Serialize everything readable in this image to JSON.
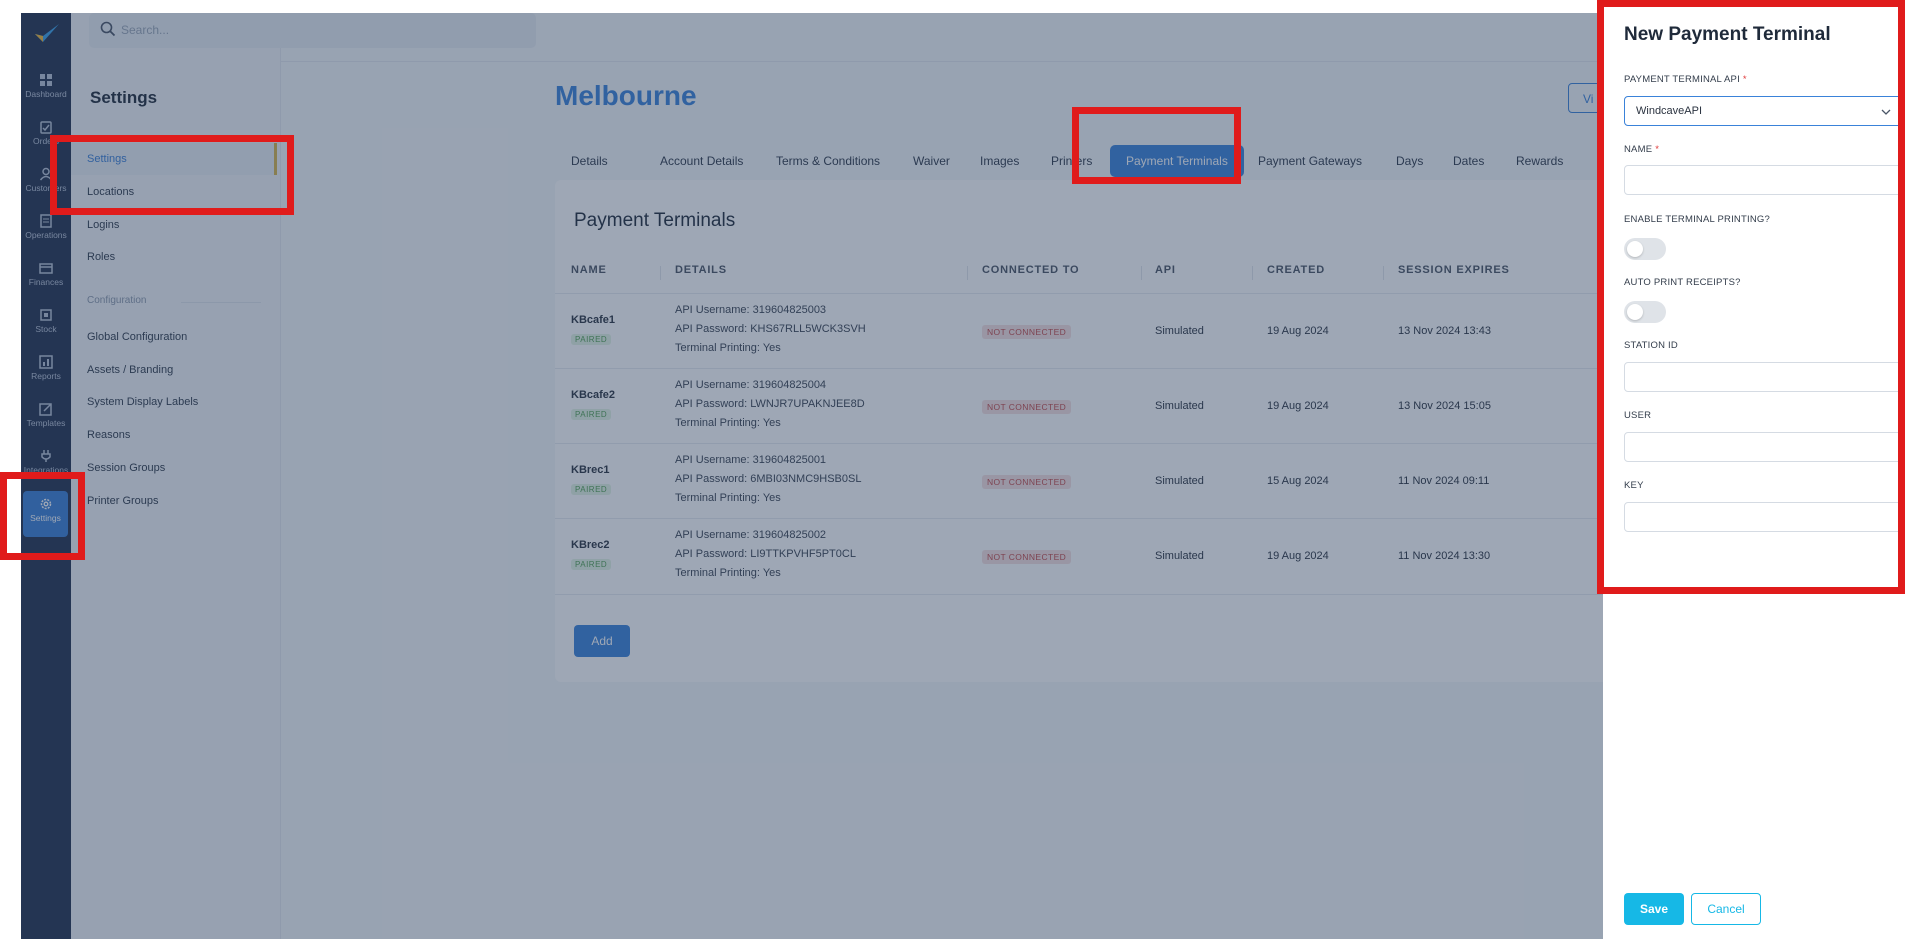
{
  "search": {
    "placeholder": "Search..."
  },
  "rail": {
    "items": [
      {
        "label": "Dashboard",
        "icon": "dashboard-icon"
      },
      {
        "label": "Orders",
        "icon": "orders-icon"
      },
      {
        "label": "Customers",
        "icon": "customers-icon"
      },
      {
        "label": "Operations",
        "icon": "operations-icon"
      },
      {
        "label": "Finances",
        "icon": "finances-icon"
      },
      {
        "label": "Stock",
        "icon": "stock-icon"
      },
      {
        "label": "Reports",
        "icon": "reports-icon"
      },
      {
        "label": "Templates",
        "icon": "templates-icon"
      },
      {
        "label": "Integrations",
        "icon": "integrations-icon"
      },
      {
        "label": "Settings",
        "icon": "gear-icon"
      }
    ]
  },
  "sidebar": {
    "title": "Settings",
    "items": [
      {
        "label": "Settings",
        "active": true
      },
      {
        "label": "Locations"
      },
      {
        "label": "Logins"
      },
      {
        "label": "Roles"
      }
    ],
    "section_label": "Configuration",
    "config_items": [
      {
        "label": "Global Configuration"
      },
      {
        "label": "Assets / Branding"
      },
      {
        "label": "System Display Labels"
      },
      {
        "label": "Reasons"
      },
      {
        "label": "Session Groups"
      },
      {
        "label": "Printer Groups"
      }
    ]
  },
  "main": {
    "location_title": "Melbourne",
    "view_button": "Vi",
    "tabs": [
      "Details",
      "Account Details",
      "Terms & Conditions",
      "Waiver",
      "Images",
      "Printers",
      "Payment Terminals",
      "Payment Gateways",
      "Days",
      "Dates",
      "Rewards"
    ],
    "active_tab": "Payment Terminals",
    "card_title": "Payment Terminals",
    "columns": [
      "NAME",
      "DETAILS",
      "CONNECTED TO",
      "API",
      "CREATED",
      "SESSION EXPIRES"
    ],
    "rows": [
      {
        "name": "KBcafe1",
        "status": "PAIRED",
        "details": [
          "API Username: 319604825003",
          "API Password: KHS67RLL5WCK3SVH",
          "Terminal Printing: Yes"
        ],
        "connected": "NOT CONNECTED",
        "api": "Simulated",
        "created": "19 Aug 2024",
        "expires": "13 Nov 2024 13:43"
      },
      {
        "name": "KBcafe2",
        "status": "PAIRED",
        "details": [
          "API Username: 319604825004",
          "API Password: LWNJR7UPAKNJEE8D",
          "Terminal Printing: Yes"
        ],
        "connected": "NOT CONNECTED",
        "api": "Simulated",
        "created": "19 Aug 2024",
        "expires": "13 Nov 2024 15:05"
      },
      {
        "name": "KBrec1",
        "status": "PAIRED",
        "details": [
          "API Username: 319604825001",
          "API Password: 6MBI03NMC9HSB0SL",
          "Terminal Printing: Yes"
        ],
        "connected": "NOT CONNECTED",
        "api": "Simulated",
        "created": "15 Aug 2024",
        "expires": "11 Nov 2024 09:11"
      },
      {
        "name": "KBrec2",
        "status": "PAIRED",
        "details": [
          "API Username: 319604825002",
          "API Password: LI9TTKPVHF5PT0CL",
          "Terminal Printing: Yes"
        ],
        "connected": "NOT CONNECTED",
        "api": "Simulated",
        "created": "19 Aug 2024",
        "expires": "11 Nov 2024 13:30"
      }
    ],
    "add_button": "Add"
  },
  "drawer": {
    "title": "New Payment Terminal",
    "api_label": "PAYMENT TERMINAL API",
    "api_value": "WindcaveAPI",
    "name_label": "NAME",
    "name_value": "",
    "printing_label": "ENABLE TERMINAL PRINTING?",
    "printing_enabled": false,
    "auto_print_label": "AUTO PRINT RECEIPTS?",
    "auto_print_enabled": false,
    "station_label": "STATION ID",
    "station_value": "",
    "user_label": "USER",
    "user_value": "",
    "key_label": "KEY",
    "key_value": "",
    "save": "Save",
    "cancel": "Cancel"
  },
  "colors": {
    "accent": "#3a82d9",
    "rail": "#22304d",
    "highlight": "#e01b1b",
    "save": "#16b8e6"
  }
}
